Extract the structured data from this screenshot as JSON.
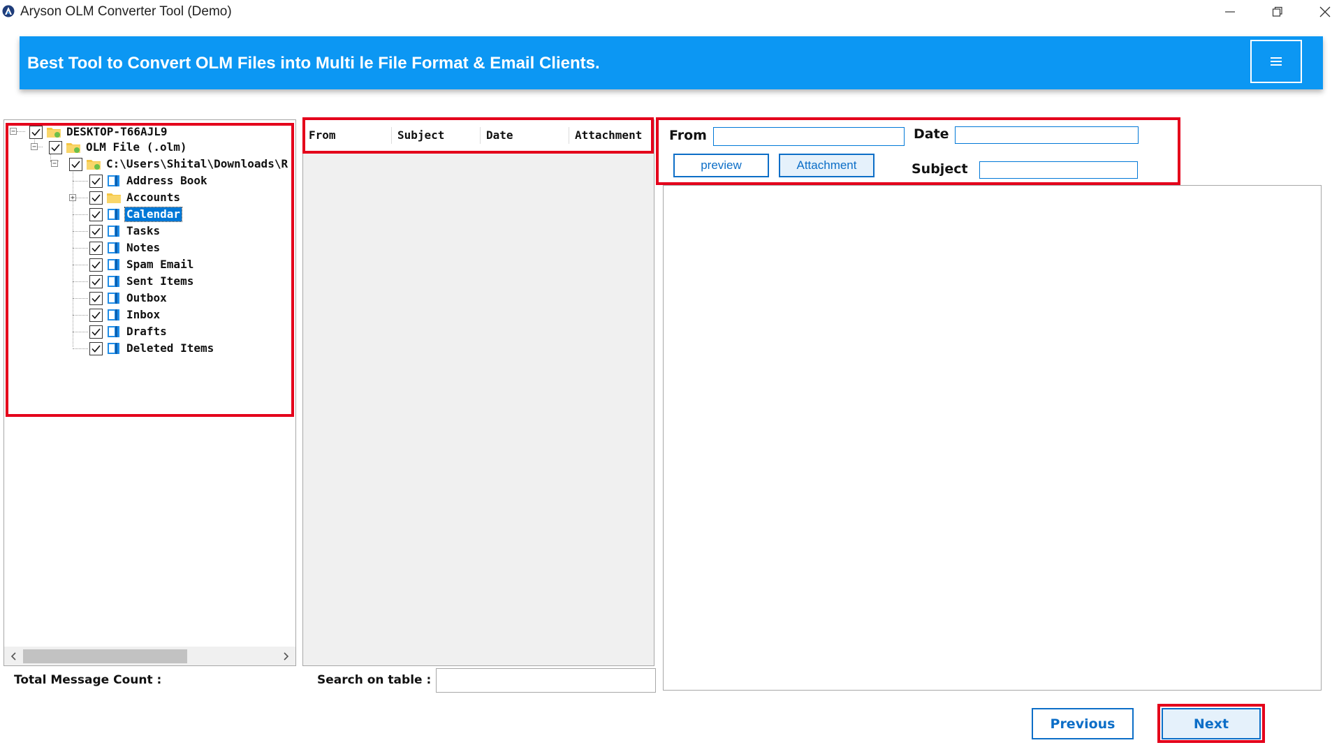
{
  "window": {
    "title": "Aryson OLM Converter Tool (Demo)",
    "icons": {
      "app": "aryson-logo-icon",
      "minimize": "minimize-icon",
      "maximize": "restore-icon",
      "close": "close-icon"
    }
  },
  "banner": {
    "text": "Best Tool to Convert OLM Files into Multi le File Format & Email Clients.",
    "menu_icon": "hamburger-menu-icon",
    "color": "#0c97f3"
  },
  "tree": {
    "nodes": [
      {
        "label": "DESKTOP-T66AJL9",
        "checked": true,
        "icon": "folder-icon",
        "expander": "−"
      },
      {
        "label": "OLM File (.olm)",
        "checked": true,
        "icon": "folder-icon",
        "expander": "−"
      },
      {
        "label": "C:\\Users\\Shital\\Downloads\\R",
        "checked": true,
        "icon": "folder-icon",
        "expander": "−"
      },
      {
        "label": "Address Book",
        "checked": true,
        "icon": "book-icon"
      },
      {
        "label": "Accounts",
        "checked": true,
        "icon": "folder-icon",
        "expander": "+"
      },
      {
        "label": "Calendar",
        "checked": true,
        "icon": "book-icon",
        "selected": true
      },
      {
        "label": "Tasks",
        "checked": true,
        "icon": "book-icon"
      },
      {
        "label": "Notes",
        "checked": true,
        "icon": "book-icon"
      },
      {
        "label": "Spam Email",
        "checked": true,
        "icon": "book-icon"
      },
      {
        "label": "Sent Items",
        "checked": true,
        "icon": "book-icon"
      },
      {
        "label": "Outbox",
        "checked": true,
        "icon": "book-icon"
      },
      {
        "label": "Inbox",
        "checked": true,
        "icon": "book-icon"
      },
      {
        "label": "Drafts",
        "checked": true,
        "icon": "book-icon"
      },
      {
        "label": "Deleted Items",
        "checked": true,
        "icon": "book-icon"
      }
    ],
    "total_count_label": "Total Message Count :"
  },
  "message_list": {
    "columns": [
      "From",
      "Subject",
      "Date",
      "Attachment"
    ],
    "search_label": "Search on table :",
    "search_value": ""
  },
  "preview": {
    "from_label": "From",
    "from_value": "",
    "date_label": "Date",
    "date_value": "",
    "subject_label": "Subject",
    "subject_value": "",
    "preview_button": "preview",
    "attachment_button": "Attachment"
  },
  "nav": {
    "previous": "Previous",
    "next": "Next"
  },
  "colors": {
    "highlight": "#e4001b",
    "accent": "#0c6ec7",
    "selection": "#0078d7"
  }
}
